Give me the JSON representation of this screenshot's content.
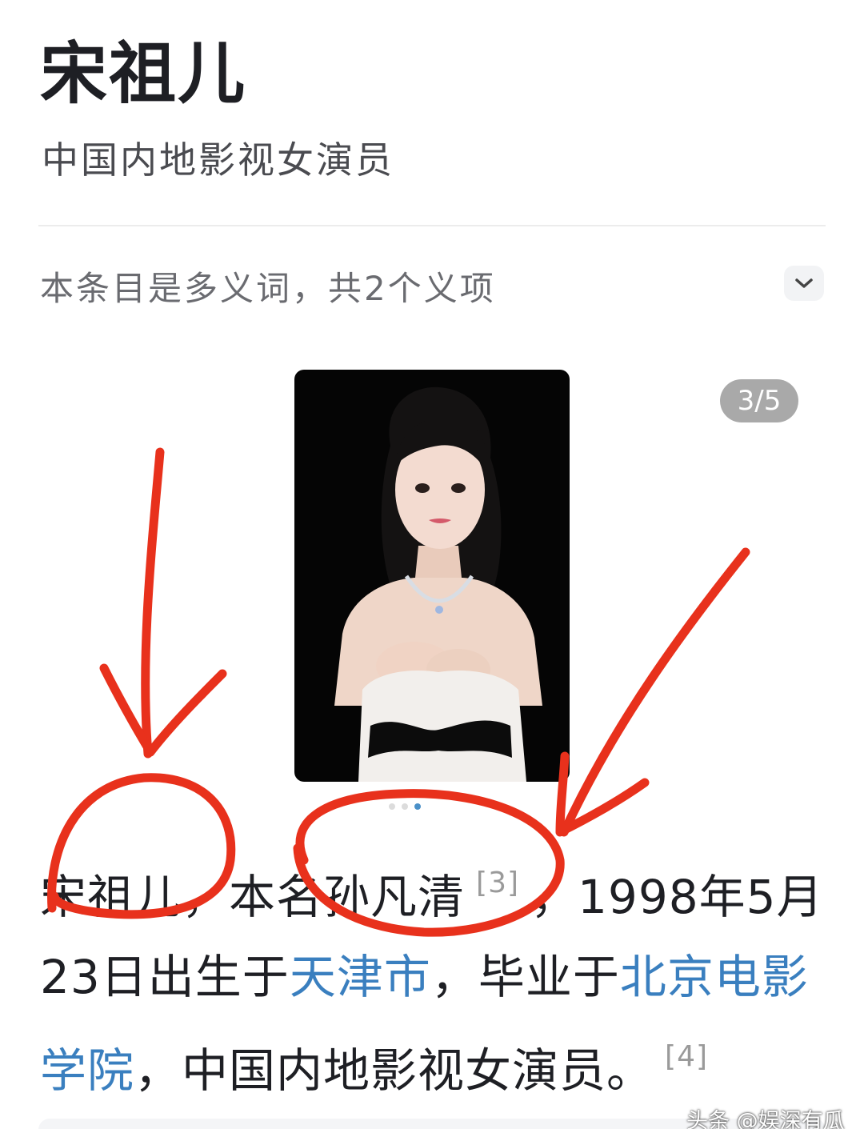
{
  "entry": {
    "title": "宋祖儿",
    "subtitle": "中国内地影视女演员"
  },
  "polysemy": {
    "label": "本条目是多义词，共2个义项",
    "expand_icon": "chevron-down-icon"
  },
  "gallery": {
    "counter": "3/5",
    "photo_icon": "portrait-photo",
    "dots_count": 3,
    "active_dot": 2
  },
  "intro": {
    "name": "宋祖儿",
    "t1": "，本名孙凡清",
    "ref1": "[3]",
    "t2": "，1998年5月23日出生于",
    "link_city": "天津市",
    "t3": "，毕业于",
    "link_school": "北京电影学院",
    "t4": "，中国内地影视女演员。",
    "ref2": "[4]"
  },
  "watermark": "头条 @娱深有瓜",
  "colors": {
    "link": "#3a7fbf",
    "annotation_red": "#e8311c"
  }
}
